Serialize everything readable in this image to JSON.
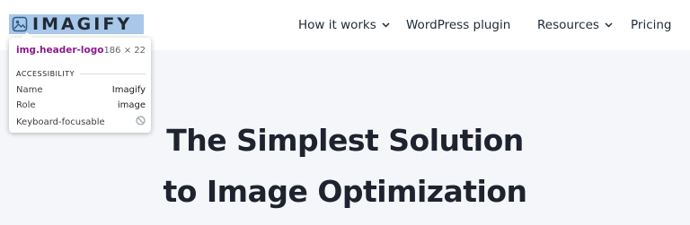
{
  "header": {
    "logo_text": "IMAGIFY",
    "logo_icon": "imagify-logo-mark",
    "nav": [
      {
        "label": "How it works",
        "has_dropdown": true
      },
      {
        "label": "WordPress plugin",
        "has_dropdown": false
      },
      {
        "label": "Resources",
        "has_dropdown": true
      },
      {
        "label": "Pricing",
        "has_dropdown": false
      }
    ]
  },
  "hero": {
    "title_line1": "The Simplest Solution",
    "title_line2": "to Image Optimization"
  },
  "inspect_tooltip": {
    "selector": "img.header-logo",
    "size": "186 × 22",
    "section": "ACCESSIBILITY",
    "rows": [
      {
        "label": "Name",
        "value": "Imagify"
      },
      {
        "label": "Role",
        "value": "image"
      },
      {
        "label": "Keyboard-focusable",
        "value_icon": "not-allowed-icon"
      }
    ]
  },
  "colors": {
    "logo_highlight": "#a9c7e8",
    "hero_background": "#f4f6f9",
    "text_dark": "#1f2a36",
    "selector_purple": "#8b1b8c"
  }
}
